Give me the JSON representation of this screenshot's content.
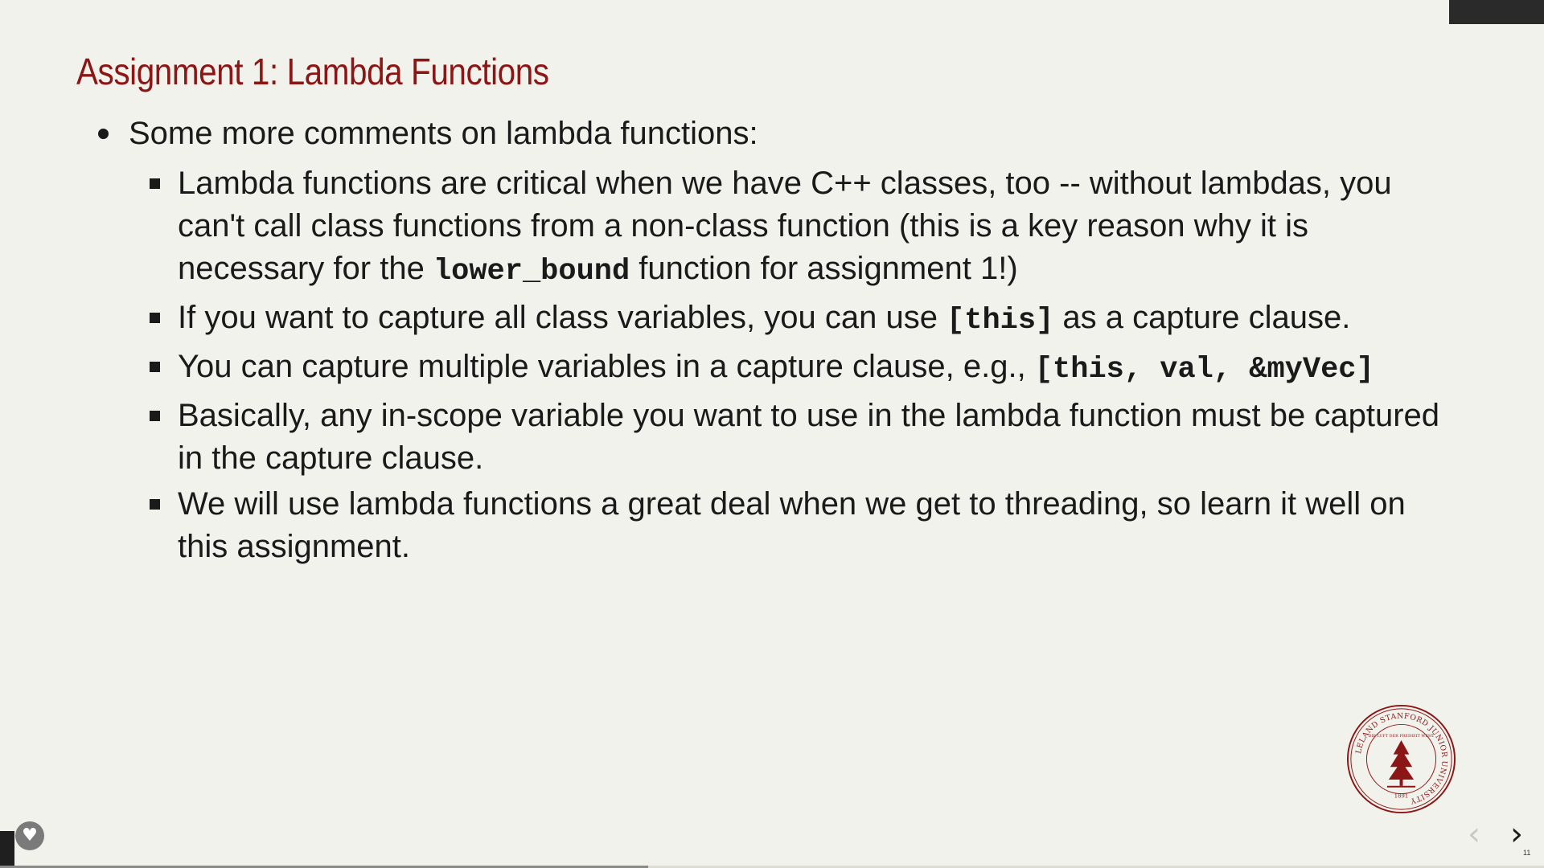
{
  "slide": {
    "title": "Assignment 1: Lambda Functions",
    "bullet": "Some more comments on lambda functions:",
    "subitems": [
      {
        "pre": "Lambda functions are critical when we have C++ classes, too -- without lambdas, you can't call class functions from a non-class function (this is a key reason why it is necessary for the ",
        "code": "lower_bound",
        "post": " function for assignment 1!)"
      },
      {
        "pre": "If you want to capture all class variables, you can use ",
        "code": "[this]",
        "post": " as a capture clause."
      },
      {
        "pre": "You can capture multiple variables in a capture clause, e.g., ",
        "code": "[this, val, &myVec]",
        "post": ""
      },
      {
        "pre": "Basically, any in-scope variable you want to use in the lambda function must be captured in the capture clause.",
        "code": "",
        "post": ""
      },
      {
        "pre": "We will use lambda functions a great deal when we get to threading, so learn it well on this assignment.",
        "code": "",
        "post": ""
      }
    ]
  },
  "seal": {
    "ring_text": "LELAND STANFORD JUNIOR UNIVERSITY",
    "motto": "DIE LUFT DER FREIHEIT WEHT",
    "year": "1891"
  },
  "nav": {
    "prev_icon": "chevron-left-icon",
    "next_icon": "chevron-right-icon",
    "page_number": "11",
    "progress": 0.42
  },
  "colors": {
    "background": "#f2f2ec",
    "title": "#8c1515",
    "text": "#1a1a1a"
  }
}
